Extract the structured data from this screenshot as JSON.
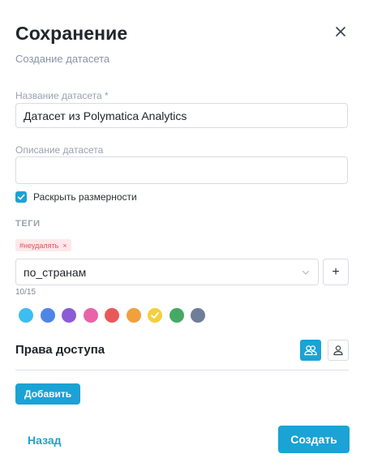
{
  "dialog": {
    "title": "Сохранение",
    "subtitle": "Создание датасета"
  },
  "form": {
    "name_label": "Название датасета *",
    "name_value": "Датасет из Polymatica Analytics",
    "description_label": "Описание датасета",
    "description_value": "",
    "expand_dimensions_label": "Раскрыть размерности",
    "expand_dimensions_checked": true
  },
  "tags": {
    "section_label": "ТЕГИ",
    "chips": [
      {
        "label": "#неудалять",
        "remove": "×"
      }
    ],
    "selected_tag": "по_странам",
    "add_symbol": "+",
    "counter": "10/15",
    "colors": [
      {
        "name": "sky-blue",
        "hex": "#3dbdf0",
        "selected": false
      },
      {
        "name": "blue",
        "hex": "#4f86e6",
        "selected": false
      },
      {
        "name": "purple",
        "hex": "#8b5cd6",
        "selected": false
      },
      {
        "name": "pink",
        "hex": "#e863a8",
        "selected": false
      },
      {
        "name": "red",
        "hex": "#e85a5a",
        "selected": false
      },
      {
        "name": "orange",
        "hex": "#f0a03c",
        "selected": false
      },
      {
        "name": "yellow",
        "hex": "#f5cf3c",
        "selected": true
      },
      {
        "name": "green",
        "hex": "#45a963",
        "selected": false
      },
      {
        "name": "slate",
        "hex": "#6f7d99",
        "selected": false
      }
    ]
  },
  "access": {
    "title": "Права доступа",
    "mode_group_icon": "users-icon",
    "mode_user_icon": "user-icon",
    "add_label": "Добавить"
  },
  "footer": {
    "back_label": "Назад",
    "create_label": "Создать"
  },
  "colors": {
    "accent": "#1aa3d4",
    "tag_bg": "#fde8ea",
    "tag_text": "#e0505c"
  }
}
